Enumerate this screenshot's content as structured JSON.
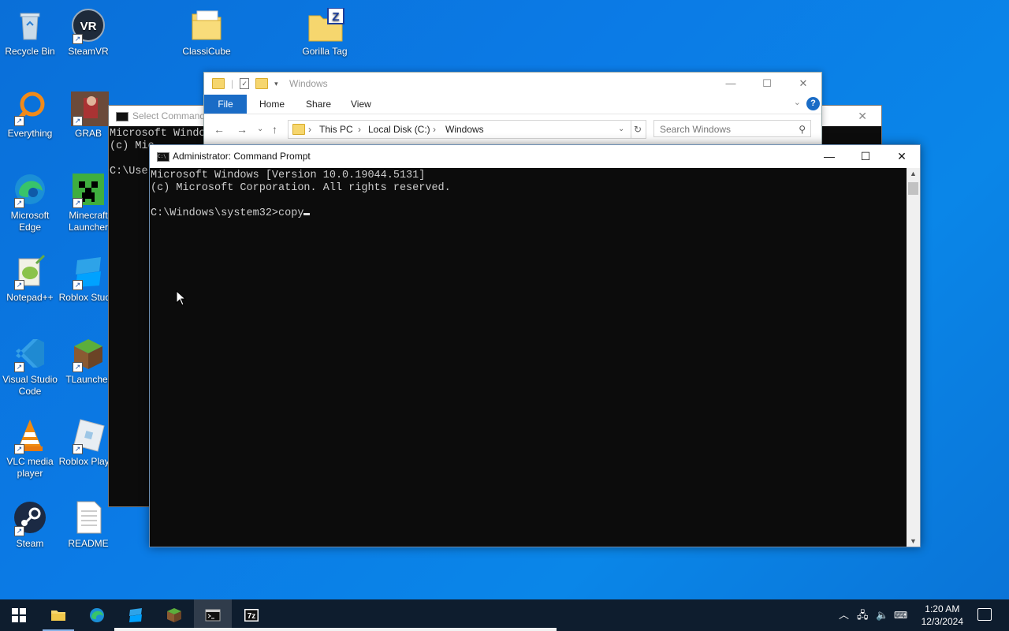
{
  "desktop_icons": [
    {
      "label": "Recycle Bin",
      "icon": "recycle-bin-icon"
    },
    {
      "label": "SteamVR",
      "icon": "steamvr-icon"
    },
    {
      "label": "ClassiCube",
      "icon": "folder-icon"
    },
    {
      "label": "Gorilla Tag",
      "icon": "zip-folder-icon"
    },
    {
      "label": "Everything",
      "icon": "everything-search-icon"
    },
    {
      "label": "GRAB",
      "icon": "grab-game-icon"
    },
    {
      "label": "Microsoft Edge",
      "icon": "edge-icon"
    },
    {
      "label": "Minecraft Launcher",
      "icon": "minecraft-creeper-icon"
    },
    {
      "label": "Notepad++",
      "icon": "notepadpp-icon"
    },
    {
      "label": "Roblox Studio",
      "icon": "roblox-studio-icon"
    },
    {
      "label": "Visual Studio Code",
      "icon": "vscode-icon"
    },
    {
      "label": "TLauncher",
      "icon": "tlauncher-grass-block-icon"
    },
    {
      "label": "VLC media player",
      "icon": "vlc-cone-icon"
    },
    {
      "label": "Roblox Player",
      "icon": "roblox-player-icon"
    },
    {
      "label": "Steam",
      "icon": "steam-icon"
    },
    {
      "label": "README",
      "icon": "text-document-icon"
    }
  ],
  "back_cmd": {
    "title": "Select Command",
    "lines": [
      "Microsoft Windo",
      "(c) Mic",
      "",
      "C:\\Use"
    ]
  },
  "explorer": {
    "title": "Windows",
    "tabs": [
      "File",
      "Home",
      "Share",
      "View"
    ],
    "path": [
      "This PC",
      "Local Disk (C:)",
      "Windows"
    ],
    "search_placeholder": "Search Windows"
  },
  "cmd": {
    "title": "Administrator: Command Prompt",
    "line1": "Microsoft Windows [Version 10.0.19044.5131]",
    "line2": "(c) Microsoft Corporation. All rights reserved.",
    "prompt": "C:\\Windows\\system32>copy"
  },
  "taskbar": {
    "apps": [
      "start-windows-icon",
      "file-explorer-icon",
      "edge-icon",
      "roblox-studio-icon",
      "minecraft-icon",
      "command-prompt-icon",
      "7zip-icon"
    ],
    "time": "1:20 AM",
    "date": "12/3/2024"
  },
  "colors": {
    "desktop_blue": "#0b7be6",
    "taskbar": "#0e1d2e",
    "explorer_file_tab": "#1a6cc6",
    "console_bg": "#0c0c0c",
    "console_text": "#cccccc"
  }
}
